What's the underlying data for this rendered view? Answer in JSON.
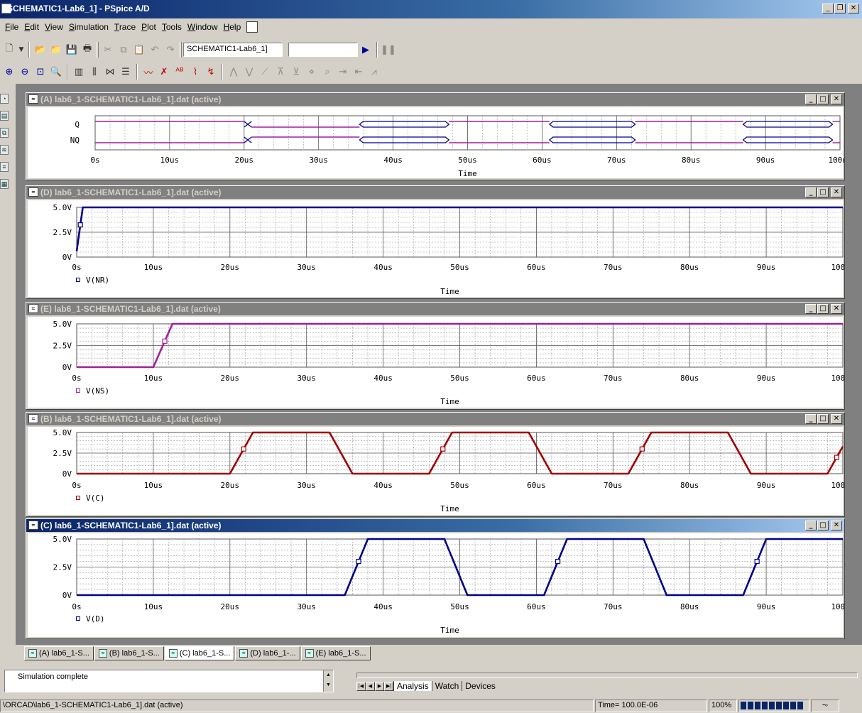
{
  "window": {
    "title": "SCHEMATIC1-Lab6_1] - PSpice A/D"
  },
  "menu": [
    {
      "key": "F",
      "rest": "ile"
    },
    {
      "key": "E",
      "rest": "dit"
    },
    {
      "key": "V",
      "rest": "iew"
    },
    {
      "key": "S",
      "rest": "imulation"
    },
    {
      "key": "T",
      "rest": "race"
    },
    {
      "key": "P",
      "rest": "lot"
    },
    {
      "key": "T",
      "rest": "ools"
    },
    {
      "key": "W",
      "rest": "indow"
    },
    {
      "key": "H",
      "rest": "elp"
    }
  ],
  "toolbar": {
    "profile_combo": "SCHEMATIC1-Lab6_1]",
    "second_combo": ""
  },
  "plots": {
    "A": {
      "title": "(A) lab6_1-SCHEMATIC1-Lab6_1].dat (active)",
      "xlabel": "Time",
      "digital_signals": [
        "Q",
        "NQ"
      ]
    },
    "D": {
      "title": "(D) lab6_1-SCHEMATIC1-Lab6_1].dat (active)",
      "xlabel": "Time",
      "legend": "V(NR)"
    },
    "E": {
      "title": "(E) lab6_1-SCHEMATIC1-Lab6_1].dat (active)",
      "xlabel": "Time",
      "legend": "V(NS)"
    },
    "B": {
      "title": "(B) lab6_1-SCHEMATIC1-Lab6_1].dat (active)",
      "xlabel": "Time",
      "legend": "V(C)"
    },
    "C": {
      "title": "(C) lab6_1-SCHEMATIC1-Lab6_1].dat (active)",
      "xlabel": "Time",
      "legend": "V(D)"
    }
  },
  "tabs": [
    "(A) lab6_1-S...",
    "(B) lab6_1-S...",
    "(C) lab6_1-S...",
    "(D) lab6_1-...",
    "(E) lab6_1-S..."
  ],
  "output": {
    "message": "Simulation complete"
  },
  "sim_tabs": [
    "Analysis",
    "Watch",
    "Devices"
  ],
  "status": {
    "path": "\\ORCAD\\lab6_1-SCHEMATIC1-Lab6_1].dat (active)",
    "time": "Time= 100.0E-06",
    "percent": "100%"
  },
  "colors": {
    "blue": "#00008b",
    "magenta": "#9e1f9e",
    "red": "#a00000",
    "title_active": "#0a246a",
    "title_inactive": "#808080"
  },
  "chart_data": [
    {
      "type": "line",
      "plot": "A",
      "digital": true,
      "series": [
        {
          "name": "Q"
        },
        {
          "name": "NQ"
        }
      ],
      "x_ticks": [
        "0s",
        "10us",
        "20us",
        "30us",
        "40us",
        "50us",
        "60us",
        "70us",
        "80us",
        "90us",
        "100us"
      ],
      "xlabel": "Time",
      "xlim": [
        0,
        100
      ],
      "events_us": [
        20,
        36,
        47,
        61,
        73,
        87,
        99
      ],
      "bus_intervals_us": [
        [
          35.5,
          47.5
        ],
        [
          61,
          72.5
        ],
        [
          87,
          99
        ]
      ]
    },
    {
      "type": "line",
      "plot": "D",
      "xlabel": "Time",
      "x_ticks": [
        "0s",
        "10us",
        "20us",
        "30us",
        "40us",
        "50us",
        "60us",
        "70us",
        "80us",
        "90us",
        "100us"
      ],
      "y_ticks": [
        "0V",
        "2.5V",
        "5.0V"
      ],
      "ylim": [
        0,
        5
      ],
      "xlim": [
        0,
        100
      ],
      "series": [
        {
          "name": "V(NR)",
          "x": [
            0,
            0.8,
            100
          ],
          "y": [
            0.6,
            5,
            5
          ]
        }
      ]
    },
    {
      "type": "line",
      "plot": "E",
      "xlabel": "Time",
      "x_ticks": [
        "0s",
        "10us",
        "20us",
        "30us",
        "40us",
        "50us",
        "60us",
        "70us",
        "80us",
        "90us",
        "100us"
      ],
      "y_ticks": [
        "0V",
        "2.5V",
        "5.0V"
      ],
      "ylim": [
        0,
        5
      ],
      "xlim": [
        0,
        100
      ],
      "series": [
        {
          "name": "V(NS)",
          "x": [
            0,
            10,
            12.5,
            100
          ],
          "y": [
            0,
            0,
            5,
            5
          ]
        }
      ]
    },
    {
      "type": "line",
      "plot": "B",
      "xlabel": "Time",
      "x_ticks": [
        "0s",
        "10us",
        "20us",
        "30us",
        "40us",
        "50us",
        "60us",
        "70us",
        "80us",
        "90us",
        "100us"
      ],
      "y_ticks": [
        "0V",
        "2.5V",
        "5.0V"
      ],
      "ylim": [
        0,
        5
      ],
      "xlim": [
        0,
        100
      ],
      "series": [
        {
          "name": "V(C)",
          "x": [
            0,
            20,
            23,
            33,
            36,
            46,
            49,
            59,
            62,
            72,
            75,
            85,
            88,
            98,
            100
          ],
          "y": [
            0,
            0,
            5,
            5,
            0,
            0,
            5,
            5,
            0,
            0,
            5,
            5,
            0,
            0,
            3.3
          ]
        }
      ]
    },
    {
      "type": "line",
      "plot": "C",
      "xlabel": "Time",
      "x_ticks": [
        "0s",
        "10us",
        "20us",
        "30us",
        "40us",
        "50us",
        "60us",
        "70us",
        "80us",
        "90us",
        "100us"
      ],
      "y_ticks": [
        "0V",
        "2.5V",
        "5.0V"
      ],
      "ylim": [
        0,
        5
      ],
      "xlim": [
        0,
        100
      ],
      "series": [
        {
          "name": "V(D)",
          "x": [
            0,
            35,
            38,
            48,
            51,
            61,
            64,
            74,
            77,
            87,
            90,
            100
          ],
          "y": [
            0,
            0,
            5,
            5,
            0,
            0,
            5,
            5,
            0,
            0,
            5,
            5
          ]
        }
      ]
    }
  ]
}
